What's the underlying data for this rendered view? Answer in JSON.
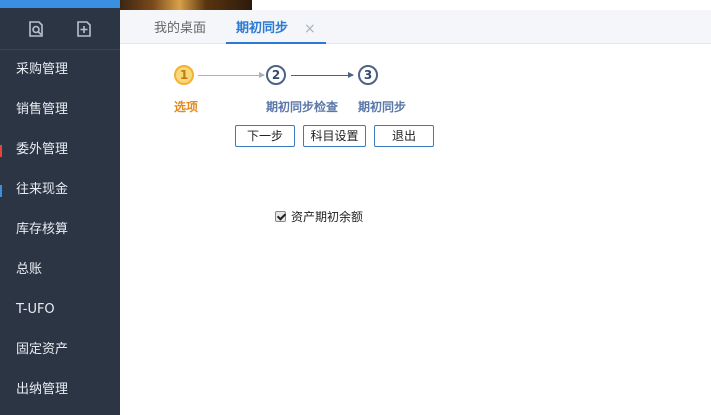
{
  "sidebar": {
    "icons": [
      "search-doc-icon",
      "add-doc-icon"
    ],
    "items": [
      {
        "label": "采购管理"
      },
      {
        "label": "销售管理"
      },
      {
        "label": "委外管理"
      },
      {
        "label": "往来现金"
      },
      {
        "label": "库存核算"
      },
      {
        "label": "总账"
      },
      {
        "label": "T-UFO"
      },
      {
        "label": "固定资产"
      },
      {
        "label": "出纳管理"
      }
    ]
  },
  "tabs": {
    "home_label": "我的桌面",
    "active_label": "期初同步",
    "close_glyph": "×"
  },
  "wizard": {
    "steps": [
      {
        "number": "1",
        "label": "选项",
        "active": true
      },
      {
        "number": "2",
        "label": "期初同步检查",
        "active": false
      },
      {
        "number": "3",
        "label": "期初同步",
        "active": false
      }
    ]
  },
  "buttons": {
    "next": "下一步",
    "account_settings": "科目设置",
    "exit": "退出"
  },
  "options": {
    "asset_balance_label": "资产期初余额",
    "asset_balance_checked": true
  },
  "colors": {
    "sidebar_bg": "#2c3544",
    "accent": "#2b7ad6",
    "active_step": "#f2b233"
  }
}
